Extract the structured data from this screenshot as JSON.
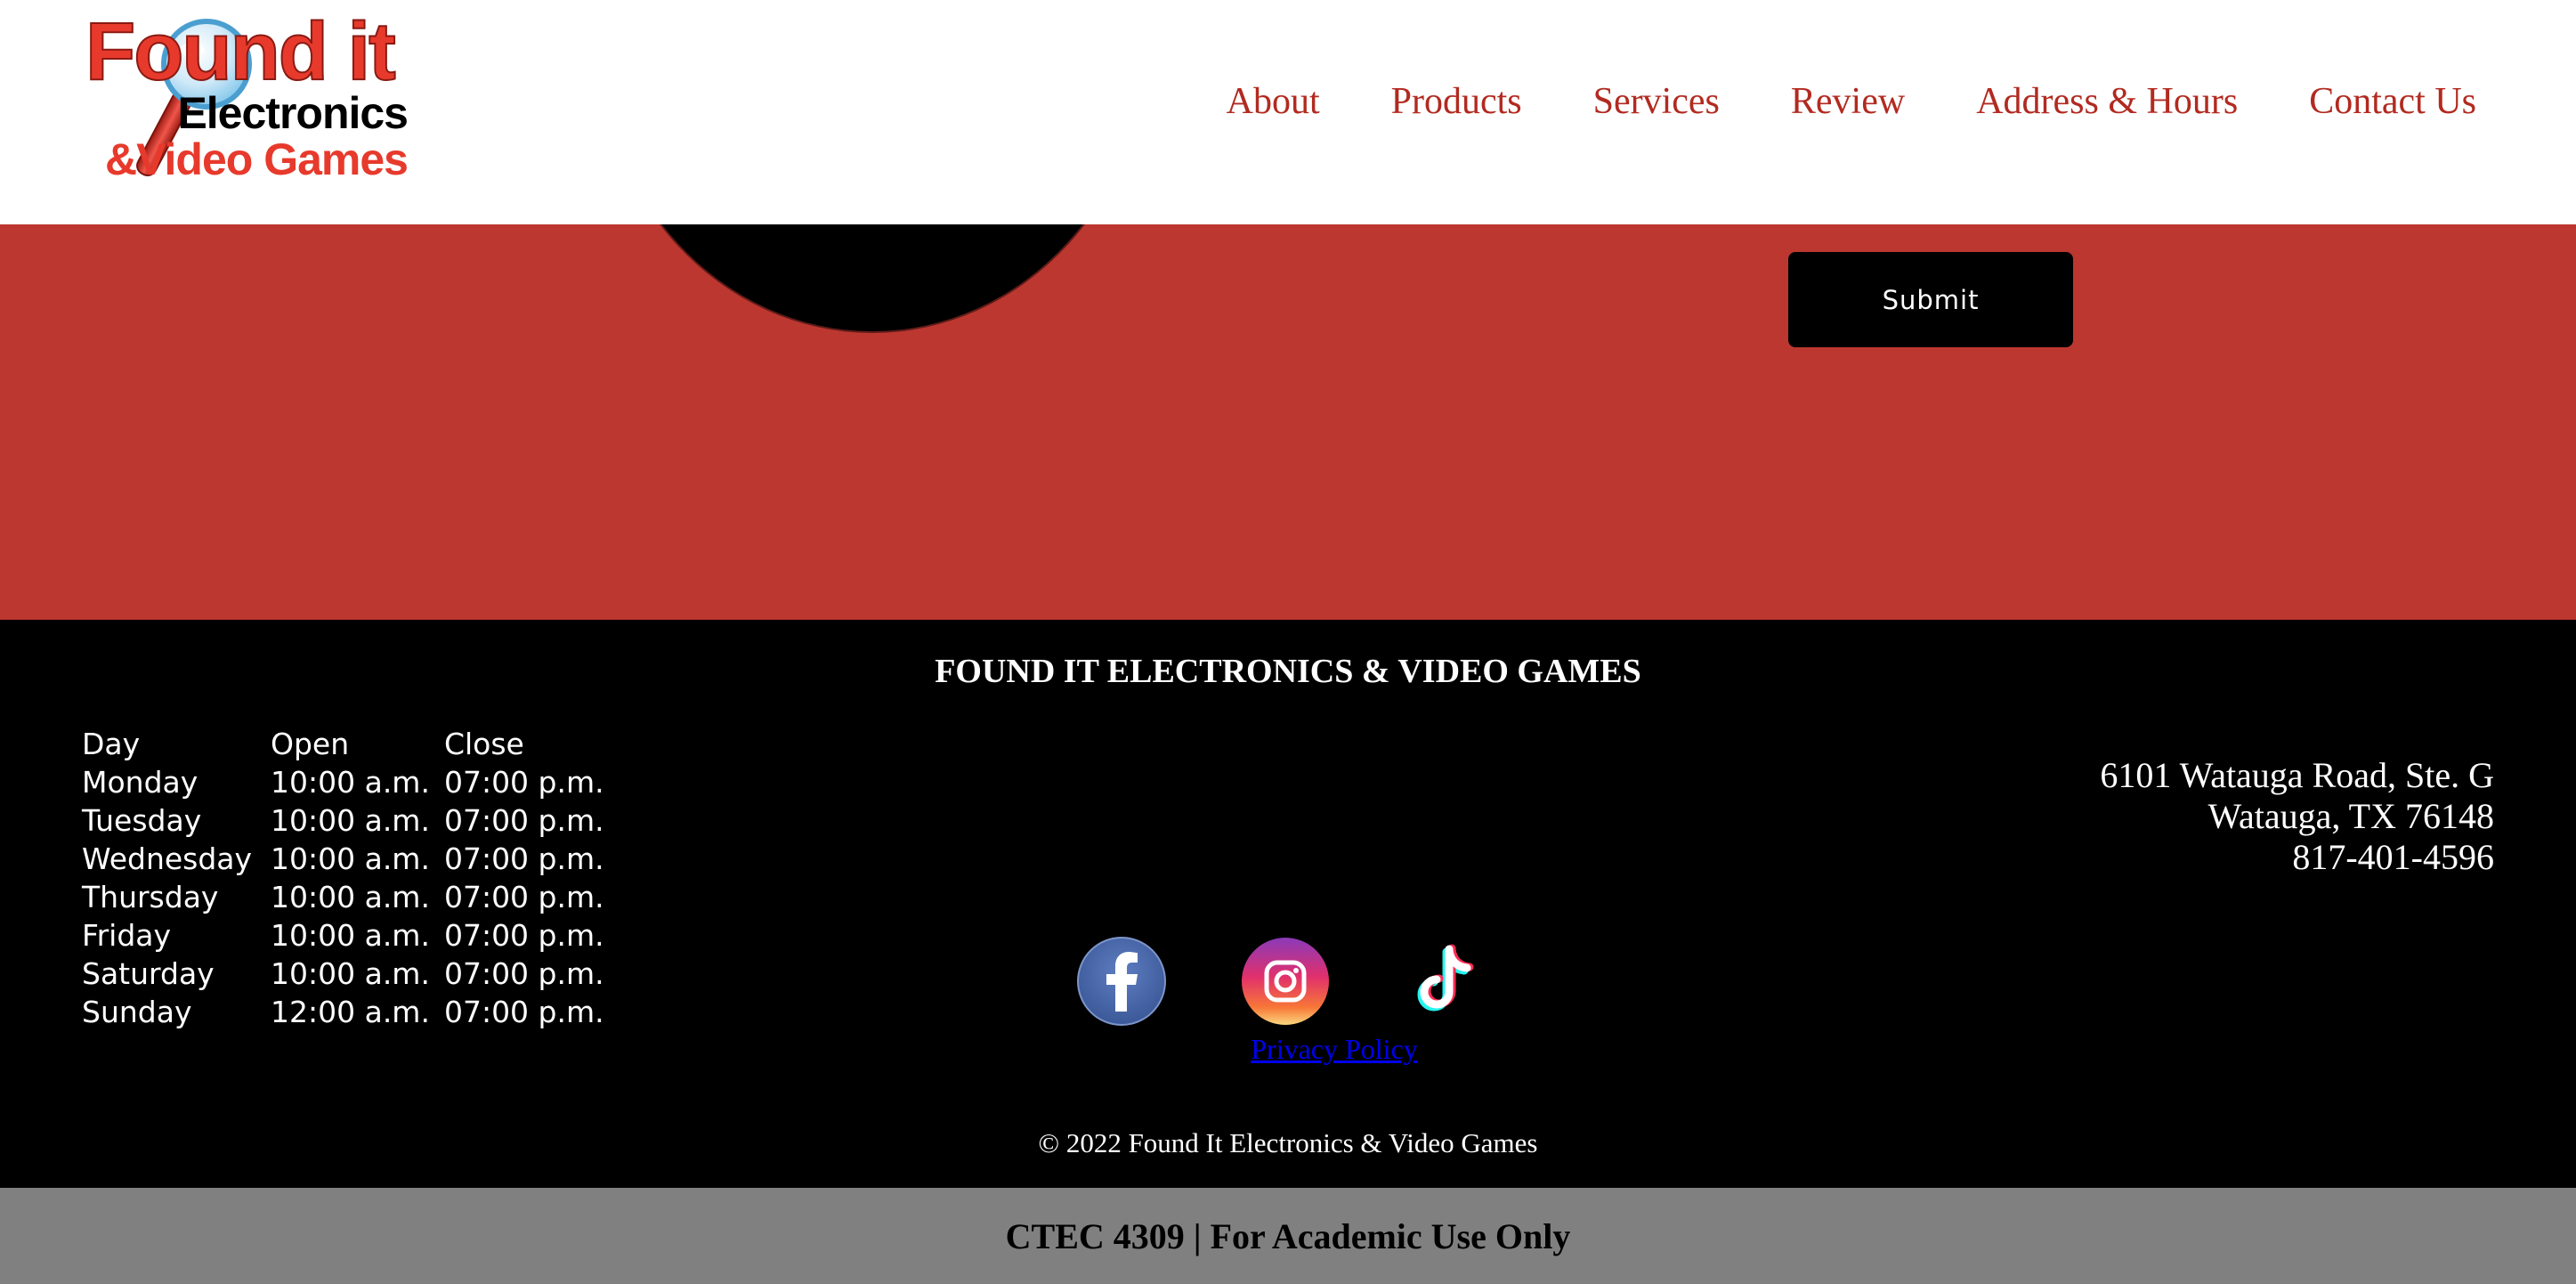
{
  "header": {
    "logo": {
      "line1": "Found it",
      "line2": "Electronics",
      "line3": "&Video Games"
    },
    "nav": [
      {
        "label": "About"
      },
      {
        "label": "Products"
      },
      {
        "label": "Services"
      },
      {
        "label": "Review"
      },
      {
        "label": "Address & Hours"
      },
      {
        "label": "Contact Us"
      }
    ]
  },
  "form": {
    "submit_label": "Submit"
  },
  "footer": {
    "title": "FOUND IT ELECTRONICS & VIDEO GAMES",
    "hours": {
      "headers": [
        "Day",
        "Open",
        "Close"
      ],
      "rows": [
        [
          "Monday",
          "10:00 a.m.",
          "07:00 p.m."
        ],
        [
          "Tuesday",
          "10:00 a.m.",
          "07:00 p.m."
        ],
        [
          "Wednesday",
          "10:00 a.m.",
          "07:00 p.m."
        ],
        [
          "Thursday",
          "10:00 a.m.",
          "07:00 p.m."
        ],
        [
          "Friday",
          "10:00 a.m.",
          "07:00 p.m."
        ],
        [
          "Saturday",
          "10:00 a.m.",
          "07:00 p.m."
        ],
        [
          "Sunday",
          "12:00 a.m.",
          "07:00 p.m."
        ]
      ]
    },
    "address": {
      "street": "6101 Watauga Road, Ste. G",
      "city": "Watauga, TX 76148",
      "phone": "817-401-4596"
    },
    "social": [
      {
        "icon": "facebook-icon"
      },
      {
        "icon": "instagram-icon"
      },
      {
        "icon": "tiktok-icon"
      }
    ],
    "privacy_label": "Privacy Policy",
    "copyright": "© 2022 Found It Electronics & Video Games"
  },
  "academic_bar": "CTEC 4309 | For Academic Use Only",
  "colors": {
    "brand_red": "#bc3730",
    "nav_red": "#b22a20",
    "footer_bg": "#000000",
    "academic_bg": "#808080",
    "link_blue": "#0000ee"
  }
}
